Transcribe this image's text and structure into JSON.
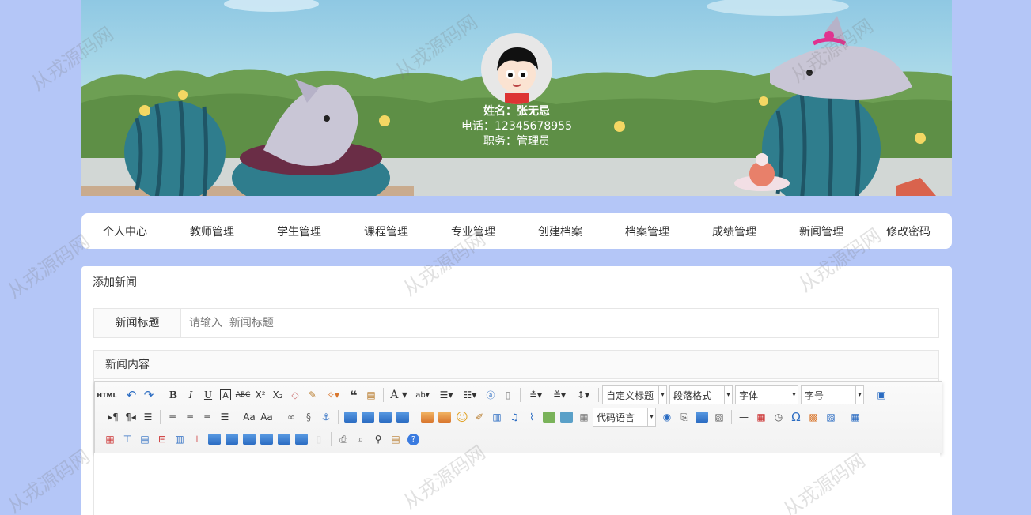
{
  "profile": {
    "name_line": "姓名：张无忌",
    "phone_line": "电话：12345678955",
    "role_line": "职务：管理员"
  },
  "nav": {
    "items": [
      "个人中心",
      "教师管理",
      "学生管理",
      "课程管理",
      "专业管理",
      "创建档案",
      "档案管理",
      "成绩管理",
      "新闻管理",
      "修改密码"
    ]
  },
  "card": {
    "title": "添加新闻",
    "title_field": {
      "label": "新闻标题",
      "placeholder": "请输入  新闻标题",
      "value": ""
    },
    "content_label": "新闻内容"
  },
  "editor": {
    "html_button": "HTML",
    "custom_title_select": "自定义标题",
    "paragraph_select": "段落格式",
    "font_select": "字体",
    "size_select": "字号",
    "code_lang_select": "代码语言"
  },
  "watermark": "从戎源码网"
}
